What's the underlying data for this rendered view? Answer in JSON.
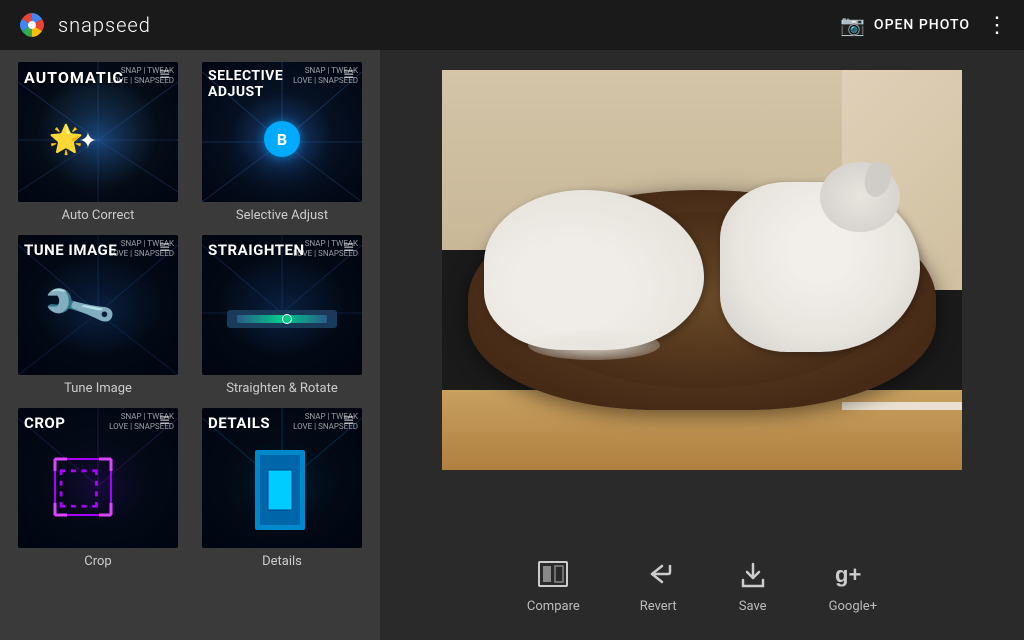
{
  "app": {
    "name": "snapseed",
    "title": "snapseed"
  },
  "header": {
    "open_photo_label": "OPEN PHOTO",
    "more_options_label": "⋮"
  },
  "tools": [
    {
      "id": "auto-correct",
      "title": "AUTOMATIC",
      "label": "Auto Correct",
      "subtitle": "SNAP | TWEAK | LOVE | SNAPSEED"
    },
    {
      "id": "selective-adjust",
      "title": "SELECTIVE ADJUST",
      "label": "Selective Adjust",
      "subtitle": "SNAP | TWEAK | LOVE | SNAPSEED"
    },
    {
      "id": "tune-image",
      "title": "TUNE IMAGE",
      "label": "Tune Image",
      "subtitle": "SNAP | TWEAK | LOVE | SNAPSEED"
    },
    {
      "id": "straighten",
      "title": "STRAIGHTEN",
      "label": "Straighten & Rotate",
      "subtitle": "SNAP | TWEAK | LOVE | SNAPSEED"
    },
    {
      "id": "crop",
      "title": "CROP",
      "label": "Crop",
      "subtitle": "SNAP | TWEAK | LOVE | SNAPSEED"
    },
    {
      "id": "details",
      "title": "DETAILS",
      "label": "Details",
      "subtitle": "SNAP | TWEAK | LOVE | SNAPSEED"
    }
  ],
  "toolbar": {
    "compare_label": "Compare",
    "revert_label": "Revert",
    "save_label": "Save",
    "google_plus_label": "Google+"
  }
}
